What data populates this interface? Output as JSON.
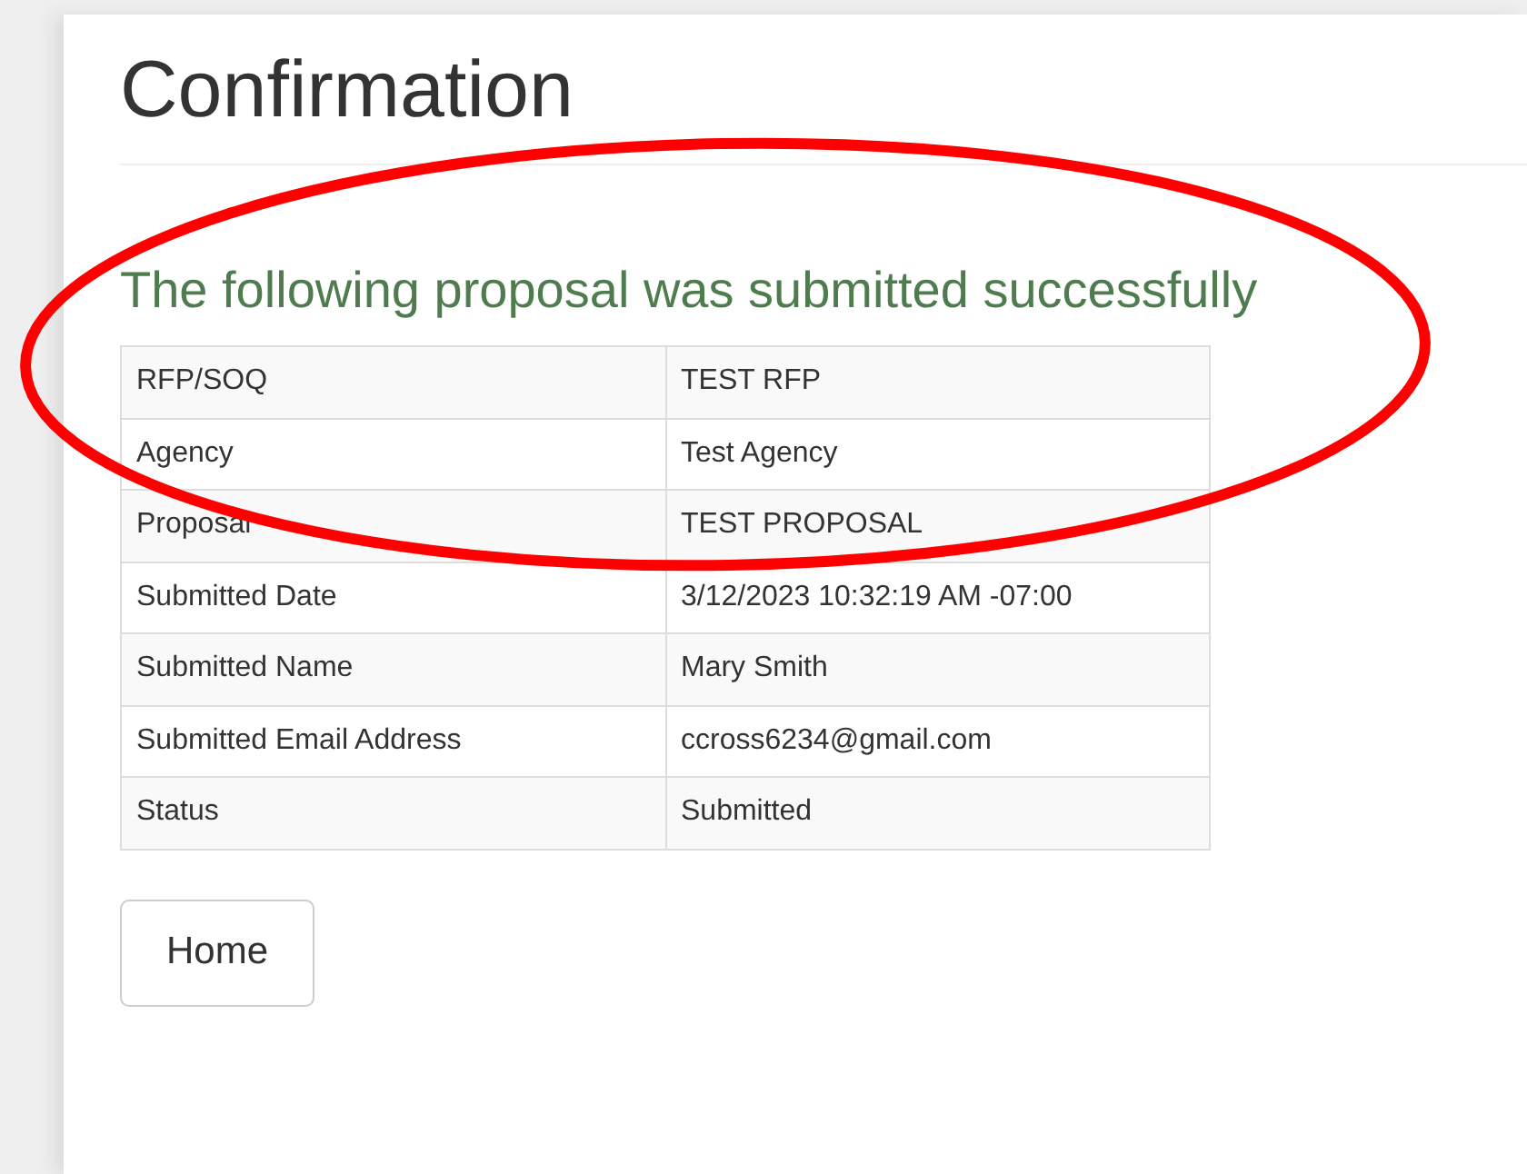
{
  "page": {
    "title": "Confirmation"
  },
  "message": "The following proposal was submitted successfully",
  "details": [
    {
      "label": "RFP/SOQ",
      "value": "TEST RFP"
    },
    {
      "label": "Agency",
      "value": "Test Agency"
    },
    {
      "label": "Proposal",
      "value": "TEST PROPOSAL"
    },
    {
      "label": "Submitted Date",
      "value": "3/12/2023 10:32:19 AM -07:00"
    },
    {
      "label": "Submitted Name",
      "value": "Mary Smith"
    },
    {
      "label": "Submitted Email Address",
      "value": "ccross6234@gmail.com"
    },
    {
      "label": "Status",
      "value": "Submitted"
    }
  ],
  "buttons": [
    "Home"
  ],
  "annotation": {
    "kind": "ellipse",
    "color": "#ff0000"
  }
}
